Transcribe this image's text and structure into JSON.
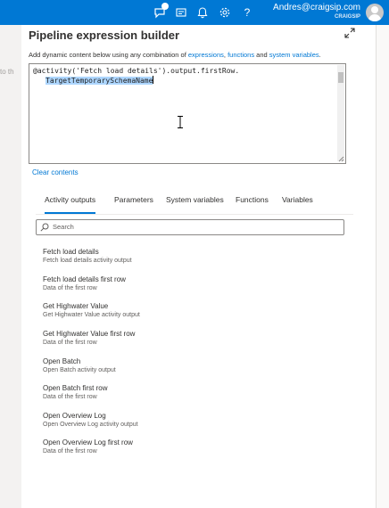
{
  "topbar": {
    "account_email": "Andres@craigsip.com",
    "account_tenant": "CRAIGSIP",
    "icons": [
      "feedback-icon",
      "directory-icon",
      "notifications-icon",
      "settings-icon",
      "help-icon"
    ],
    "help_glyph": "?",
    "bg_color": "#0078d4"
  },
  "background": {
    "partial_text": "to th"
  },
  "panel": {
    "title": "Pipeline expression builder",
    "description_prefix": "Add dynamic content below using any combination of ",
    "link_expressions": "expressions",
    "sep1": ", ",
    "link_functions": "functions",
    "sep2": " and ",
    "link_system_variables": "system variables",
    "description_suffix": ".",
    "expression_line1": "@activity('Fetch load details').output.firstRow.",
    "expression_line2": "TargetTemporarySchemaName",
    "clear_contents": "Clear contents"
  },
  "tabs": [
    {
      "label": "Activity outputs",
      "active": true
    },
    {
      "label": "Parameters",
      "active": false
    },
    {
      "label": "System variables",
      "active": false
    },
    {
      "label": "Functions",
      "active": false
    },
    {
      "label": "Variables",
      "active": false
    }
  ],
  "search": {
    "placeholder": "Search",
    "value": ""
  },
  "items": [
    {
      "name": "Fetch load details",
      "desc": "Fetch load details activity output"
    },
    {
      "name": "Fetch load details first row",
      "desc": "Data of the first row"
    },
    {
      "name": "Get Highwater Value",
      "desc": "Get Highwater Value activity output"
    },
    {
      "name": "Get Highwater Value first row",
      "desc": "Data of the first row"
    },
    {
      "name": "Open Batch",
      "desc": "Open Batch activity output"
    },
    {
      "name": "Open Batch first row",
      "desc": "Data of the first row"
    },
    {
      "name": "Open Overview Log",
      "desc": "Open Overview Log activity output"
    },
    {
      "name": "Open Overview Log first row",
      "desc": "Data of the first row"
    }
  ],
  "colors": {
    "accent": "#0078d4",
    "text": "#323130",
    "secondary_text": "#605e5c"
  }
}
